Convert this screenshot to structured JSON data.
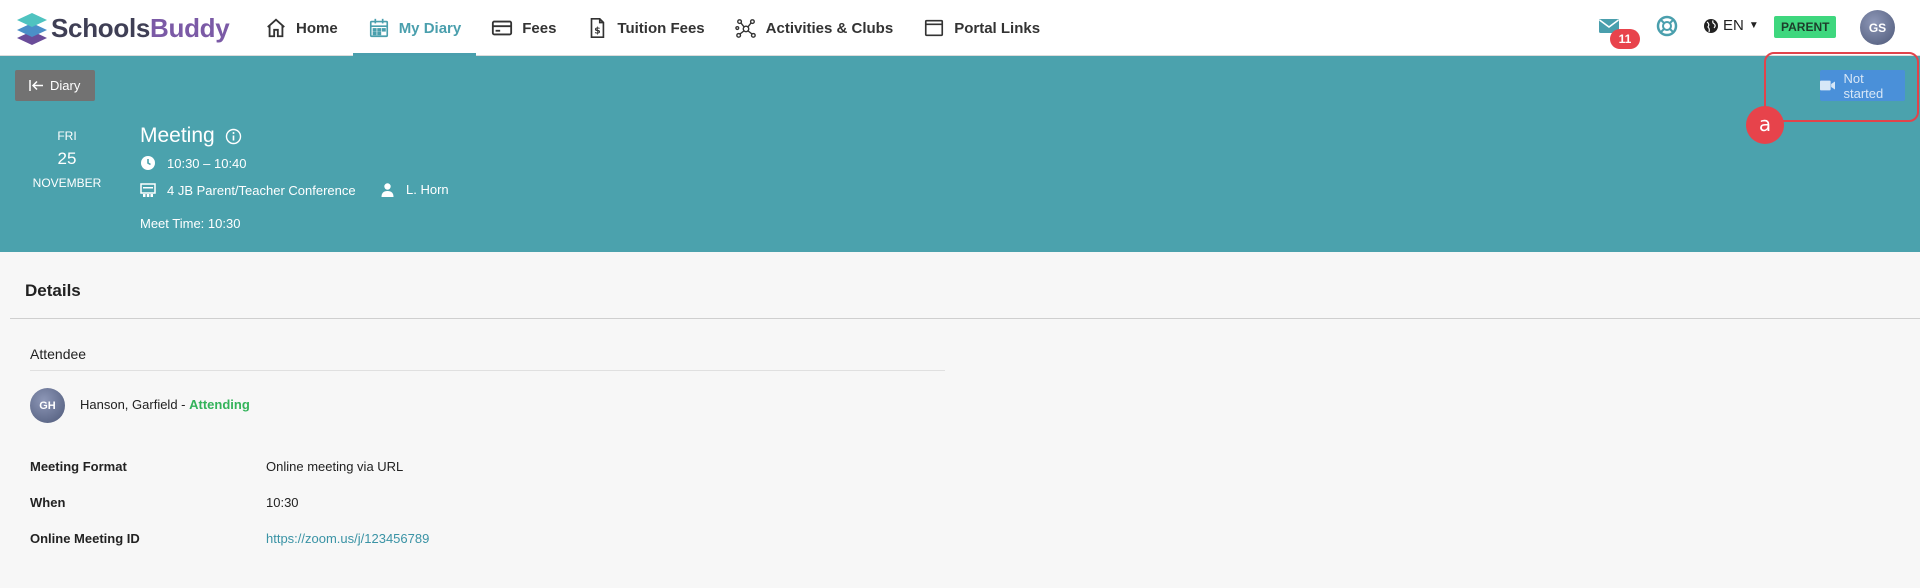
{
  "brand": {
    "name_part1": "Schools",
    "name_part2": "Buddy"
  },
  "nav": {
    "items": [
      {
        "label": "Home",
        "icon": "home-icon",
        "active": false
      },
      {
        "label": "My Diary",
        "icon": "calendar-icon",
        "active": true
      },
      {
        "label": "Fees",
        "icon": "credit-card-icon",
        "active": false
      },
      {
        "label": "Tuition Fees",
        "icon": "dollar-document-icon",
        "active": false
      },
      {
        "label": "Activities & Clubs",
        "icon": "network-icon",
        "active": false
      },
      {
        "label": "Portal Links",
        "icon": "window-icon",
        "active": false
      }
    ]
  },
  "toolbar": {
    "mail_count": "11",
    "language": "EN",
    "role_badge": "PARENT",
    "user_initials": "GS"
  },
  "event": {
    "back_label": "Diary",
    "day_of_week": "FRI",
    "day": "25",
    "month": "NOVEMBER",
    "title": "Meeting",
    "time_range": "10:30 – 10:40",
    "location": "4 JB Parent/Teacher Conference",
    "organizer": "L. Horn",
    "meet_time": "Meet Time: 10:30",
    "status_button": "Not started",
    "annotation_marker": "a"
  },
  "details": {
    "heading": "Details",
    "attendee_heading": "Attendee",
    "attendee": {
      "initials": "GH",
      "name": "Hanson, Garfield",
      "separator": " - ",
      "status": "Attending"
    },
    "rows": [
      {
        "label": "Meeting Format",
        "value": "Online meeting via URL"
      },
      {
        "label": "When",
        "value": "10:30"
      },
      {
        "label": "Online Meeting ID",
        "value": "https://zoom.us/j/123456789"
      }
    ]
  },
  "colors": {
    "teal_header": "#4ba2ad",
    "nav_active": "#4a9fad",
    "button_blue": "#4a90d9",
    "annotation_red": "#e2434b",
    "attending_green": "#33b35a",
    "parent_badge": "#3ed77e"
  }
}
